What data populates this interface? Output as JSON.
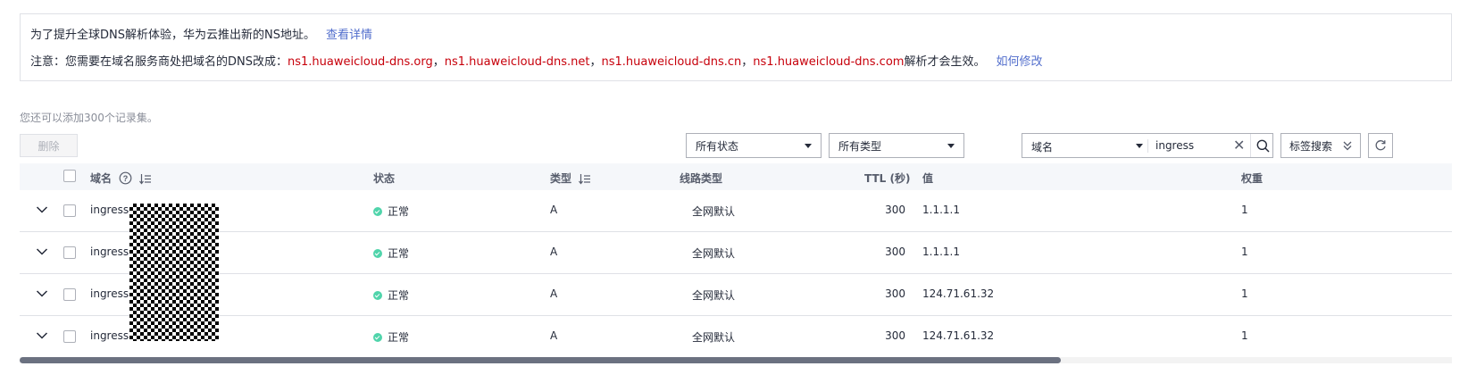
{
  "notice": {
    "line1_text": "为了提升全球DNS解析体验，华为云推出新的NS地址。",
    "line1_link": "查看详情",
    "line2_prefix": "注意：您需要在域名服务商处把域名的DNS改成：",
    "ns_servers": [
      "ns1.huaweicloud-dns.org",
      "ns1.huaweicloud-dns.net",
      "ns1.huaweicloud-dns.cn",
      "ns1.huaweicloud-dns.com"
    ],
    "separator": "，",
    "line2_suffix": "解析才会生效。",
    "line2_link": "如何修改"
  },
  "quota_text": "您还可以添加300个记录集。",
  "toolbar": {
    "delete_label": "删除",
    "status_filter": "所有状态",
    "type_filter": "所有类型",
    "search_key": "域名",
    "search_value": "ingress",
    "tag_search_label": "标签搜索"
  },
  "table": {
    "headers": {
      "name": "域名",
      "status": "状态",
      "type": "类型",
      "line": "线路类型",
      "ttl": "TTL (秒)",
      "value": "值",
      "weight": "权重"
    },
    "rows": [
      {
        "name": "ingress4",
        "status": "正常",
        "type": "A",
        "line": "全网默认",
        "ttl": "300",
        "value": "1.1.1.1",
        "weight": "1"
      },
      {
        "name": "ingress3",
        "status": "正常",
        "type": "A",
        "line": "全网默认",
        "ttl": "300",
        "value": "1.1.1.1",
        "weight": "1"
      },
      {
        "name": "ingress2",
        "status": "正常",
        "type": "A",
        "line": "全网默认",
        "ttl": "300",
        "value": "124.71.61.32",
        "weight": "1"
      },
      {
        "name": "ingress1",
        "status": "正常",
        "type": "A",
        "line": "全网默认",
        "ttl": "300",
        "value": "124.71.61.32",
        "weight": "1"
      }
    ]
  },
  "colors": {
    "link": "#526ecc",
    "ns_server": "#c7000b",
    "status_ok": "#50d4ab",
    "header_bg": "#f5f7fa"
  }
}
